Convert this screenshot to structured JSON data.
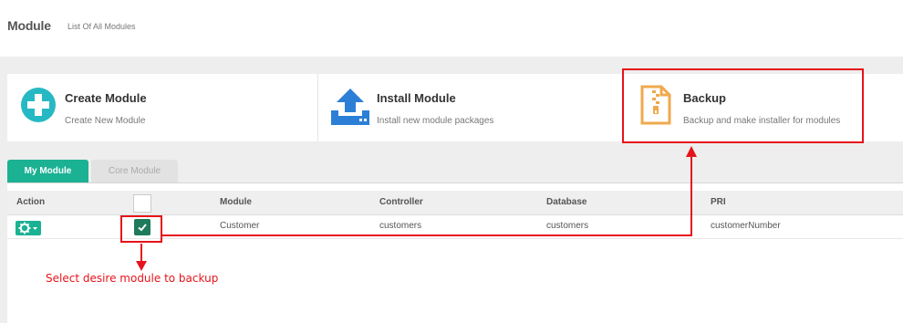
{
  "header": {
    "title": "Module",
    "subtitle": "List Of All Modules"
  },
  "cards": [
    {
      "title": "Create Module",
      "desc": "Create New Module",
      "icon": "plus-circle-icon",
      "color": "#26b9c3"
    },
    {
      "title": "Install Module",
      "desc": "Install new module packages",
      "icon": "upload-icon",
      "color": "#2b7fd6"
    },
    {
      "title": "Backup",
      "desc": "Backup and make installer for modules",
      "icon": "zip-file-icon",
      "color": "#f0a94d"
    }
  ],
  "tabs": [
    {
      "label": "My Module",
      "active": true
    },
    {
      "label": "Core Module",
      "active": false
    }
  ],
  "table": {
    "columns": [
      "Action",
      "",
      "Module",
      "Controller",
      "Database",
      "PRI"
    ],
    "rows": [
      {
        "module": "Customer",
        "controller": "customers",
        "database": "customers",
        "pri": "customerNumber",
        "checked": true
      }
    ]
  },
  "annotation": {
    "text": "Select desire module to backup",
    "color": "#e6141a"
  },
  "colors": {
    "accent": "#1bb193",
    "highlight": "#e6141a"
  }
}
